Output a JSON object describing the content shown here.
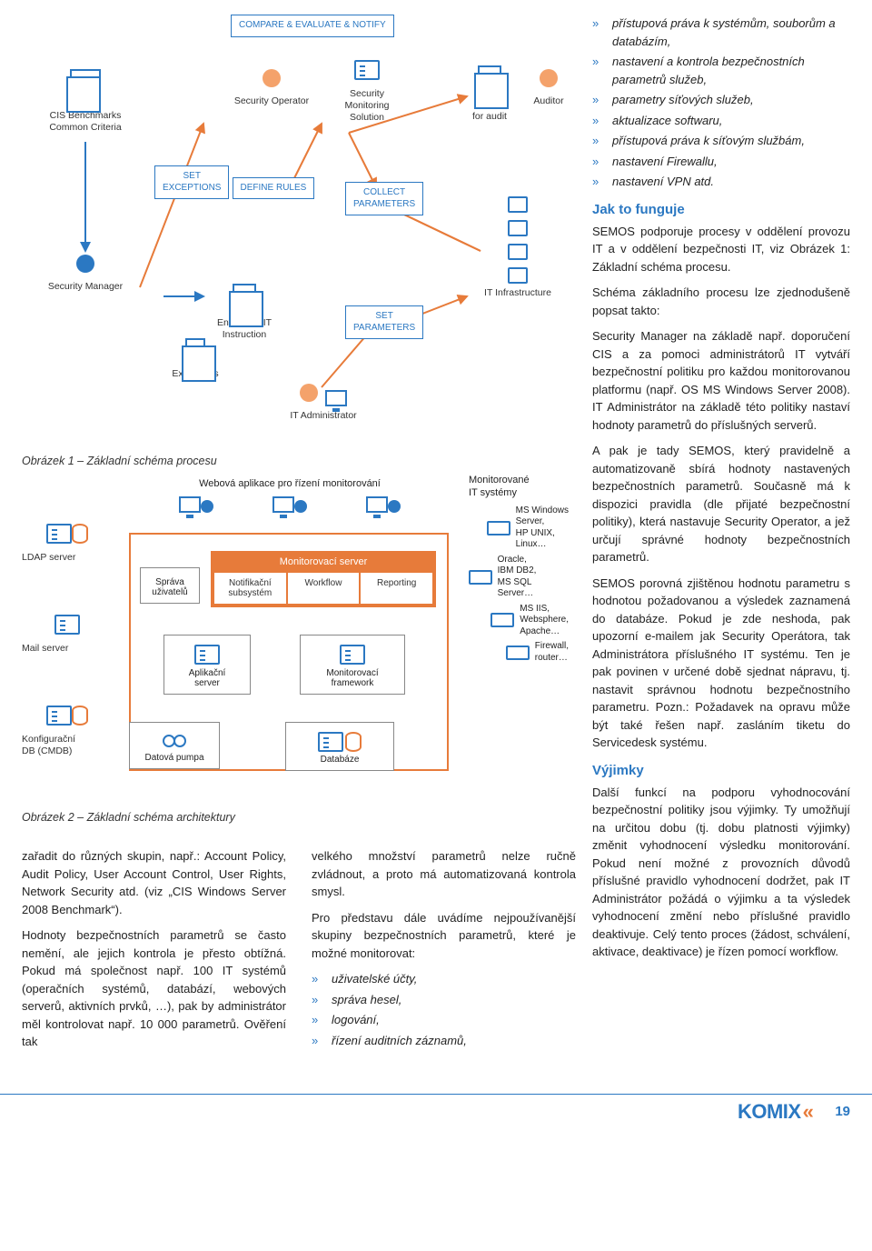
{
  "diagram": {
    "header_tag": "COMPARE & EVALUATE & NOTIFY",
    "top_left": "CIS Benchmarks\nCommon Criteria",
    "security_operator": "Security Operator",
    "security_monitoring_solution": "Security\nMonitoring\nSolution",
    "report_for_audit": "Report\nfor audit",
    "auditor": "Auditor",
    "set_exceptions": "SET\nEXCEPTIONS",
    "define_rules": "DEFINE RULES",
    "collect_parameters": "COLLECT\nPARAMETERS",
    "security_manager": "Security Manager",
    "enterprise_it_instruction": "Enterprise IT\nInstruction",
    "exceptions": "Exceptions",
    "set_parameters": "SET\nPARAMETERS",
    "it_infrastructure": "IT Infrastructure",
    "it_administrator": "IT Administrator",
    "caption1": "Obrázek 1 – Základní schéma procesu",
    "webapp": "Webová aplikace pro řízení monitorování",
    "ldap": "LDAP server",
    "mail_server": "Mail server",
    "config_db": "Konfigurační\nDB (CMDB)",
    "sprava": "Správa\nuživatelů",
    "monserver_title": "Monitorovací server",
    "notif": "Notifikační\nsubsystém",
    "workflow": "Workflow",
    "reporting": "Reporting",
    "appserver": "Aplikační\nserver",
    "monframework": "Monitorovací\nframework",
    "datapump": "Datová pumpa",
    "database": "Databáze",
    "monitored_systems_title": "Monitorované\nIT systémy",
    "sys1": "MS Windows\nServer,\nHP UNIX,\nLinux…",
    "sys2": "Oracle,\nIBM DB2,\nMS SQL Server…",
    "sys3": "MS IIS,\nWebsphere,\nApache…",
    "sys4": "Firewall,\nrouter…",
    "caption2": "Obrázek 2 – Základní schéma architektury"
  },
  "rightcol": {
    "bullets_top": [
      "přístupová práva k systémům, souborům a databázím,",
      "nastavení a kontrola bezpečnostních parametrů služeb,",
      "parametry síťových služeb,",
      "aktualizace softwaru,",
      "přístupová práva k síťovým službám,",
      "nastavení Firewallu,",
      "nastavení VPN atd."
    ],
    "h1": "Jak to funguje",
    "p1": "SEMOS podporuje procesy v oddělení provozu IT a v oddělení bezpečnosti IT, viz Obrázek 1: Základní schéma procesu.",
    "p2": "Schéma základního procesu lze zjednodušeně popsat takto:",
    "p3": "Security Manager na základě např. doporučení CIS a za pomoci administrátorů IT vytváří bezpečnostní politiku pro každou monitorovanou platformu (např. OS MS Windows Server 2008). IT Administrátor na základě této politiky nastaví hodnoty parametrů do příslušných serverů.",
    "p4": "A pak je tady SEMOS, který pravidelně a automatizovaně sbírá hodnoty nastavených bezpečnostních parametrů. Současně má k dispozici pravidla (dle přijaté bezpečnostní politiky), která nastavuje Security Operator, a jež určují správné hodnoty bezpečnostních parametrů.",
    "p5": "SEMOS porovná zjištěnou hodnotu parametru s hodnotou požadovanou a výsledek zaznamená do databáze. Pokud je zde neshoda, pak upozorní e-mailem jak Security Operátora, tak Administrátora příslušného IT systému. Ten je pak povinen v určené době sjednat nápravu, tj. nastavit správnou hodnotu bezpečnostního parametru. Pozn.: Požadavek na opravu může být také řešen např. zasláním tiketu do Servicedesk systému.",
    "h2": "Výjimky",
    "p6": "Další funkcí na podporu vyhodnocování bezpečnostní politiky jsou výjimky. Ty umožňují na určitou dobu (tj. dobu platnosti výjimky) změnit vyhodnocení výsledku monitorování. Pokud není možné z provozních důvodů příslušné pravidlo vyhodnocení dodržet, pak IT Administrátor požádá o výjimku a ta výsledek vyhodnocení změní nebo příslušné pravidlo deaktivuje. Celý tento proces (žádost, schválení, aktivace, deaktivace) je řízen pomocí workflow."
  },
  "bottom": {
    "col1_p1": "zařadit do různých skupin, např.: Account Policy, Audit Policy, User Account Control, User Rights, Network Security atd. (viz „CIS Windows Server 2008 Benchmark“).",
    "col1_p2": "Hodnoty bezpečnostních parametrů se často nemění, ale jejich kontrola je přesto obtížná. Pokud má společnost např. 100 IT systémů (operačních systémů, databází, webových serverů, aktivních prvků, …), pak by administrátor měl kontrolovat např. 10 000 parametrů. Ověření tak",
    "col2_p1": "velkého množství parametrů nelze ručně zvládnout, a proto má automatizovaná kontrola smysl.",
    "col2_p2": "Pro představu dále uvádíme nejpoužívanější skupiny bezpečnostních parametrů, které je možné monitorovat:",
    "col2_bullets": [
      "uživatelské účty,",
      "správa hesel,",
      "logování,",
      "řízení auditních záznamů,"
    ]
  },
  "footer": {
    "brand": "KOMIX",
    "pagenum": "19"
  }
}
